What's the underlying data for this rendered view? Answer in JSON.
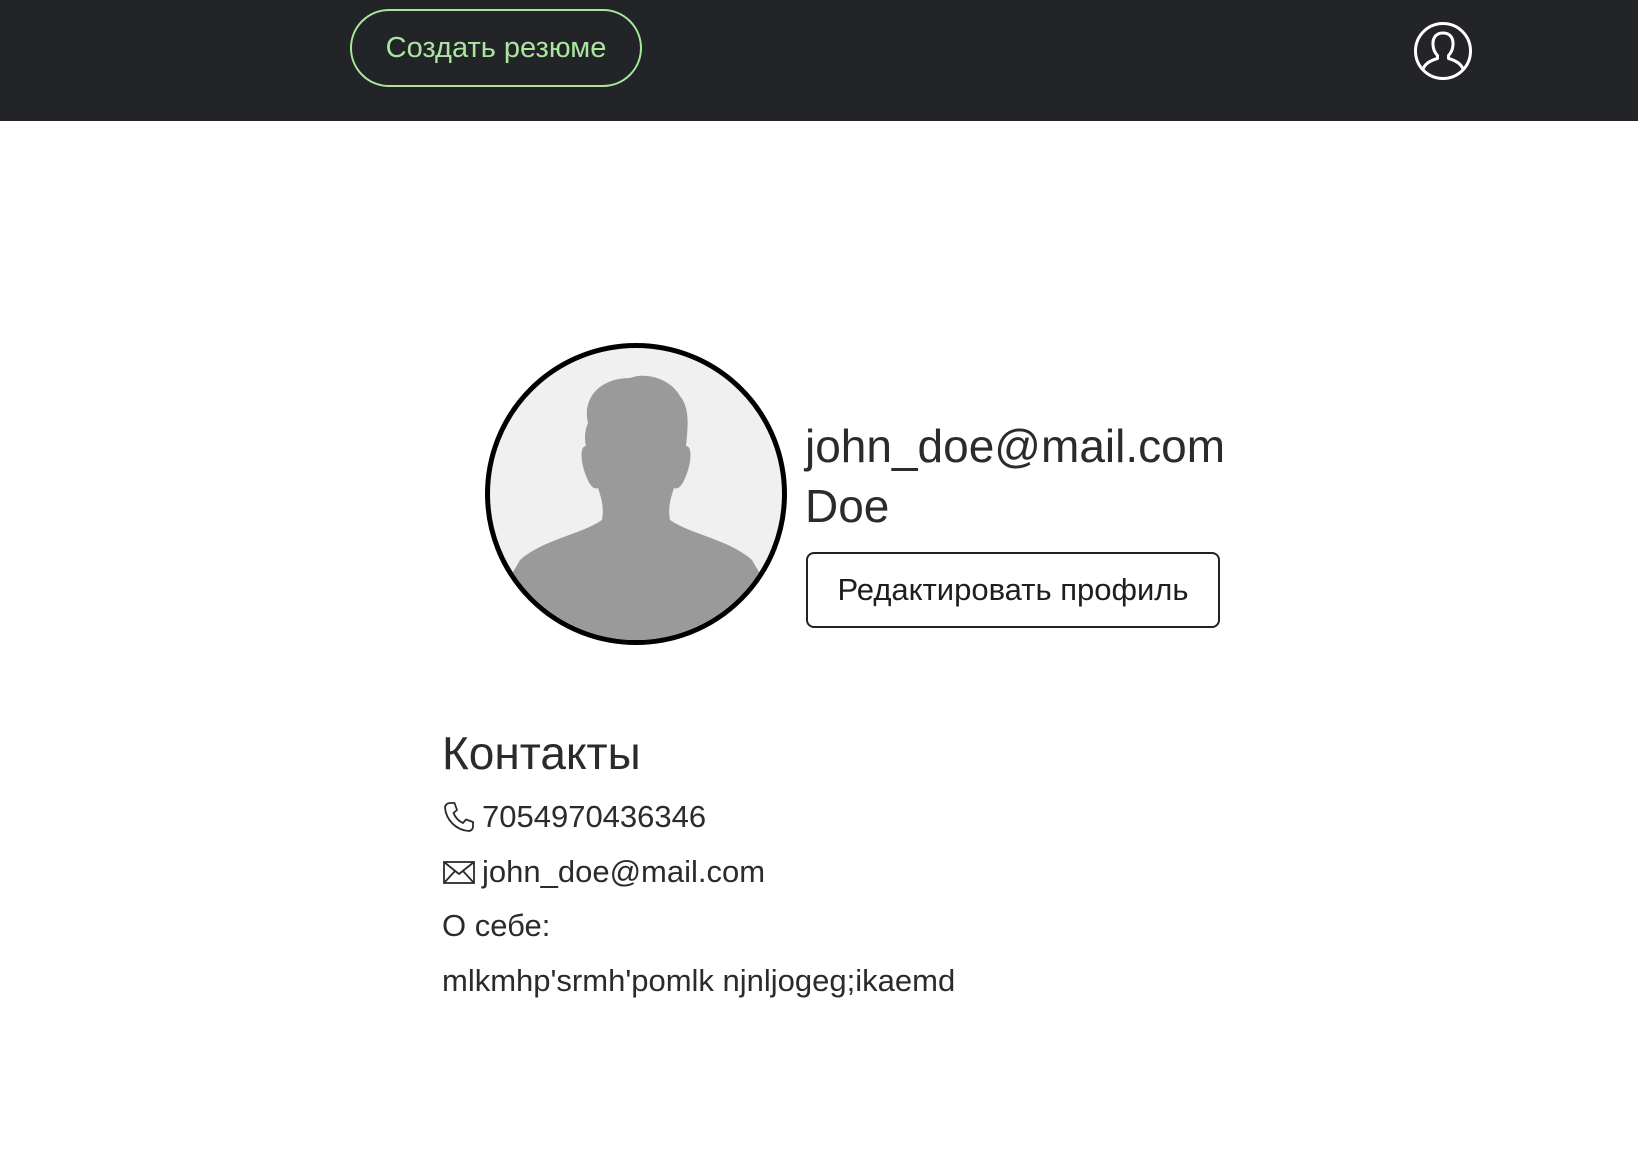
{
  "header": {
    "create_resume_label": "Создать резюме",
    "account_icon": "user-circle-icon",
    "accent_color": "#a8e6a0",
    "background_color": "#232427"
  },
  "profile": {
    "avatar_icon": "person-silhouette-icon",
    "email": "john_doe@mail.com",
    "surname": "Doe",
    "edit_label": "Редактировать профиль"
  },
  "contacts": {
    "title": "Контакты",
    "phone_icon": "phone-icon",
    "phone": "7054970436346",
    "mail_icon": "envelope-icon",
    "email": "john_doe@mail.com",
    "about_label": "О себе:",
    "about_text": "mlkmhp'srmh'pomlk njnljogeg;ikaemd"
  }
}
